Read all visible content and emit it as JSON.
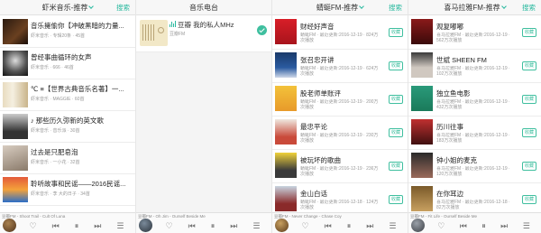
{
  "colors": {
    "accent": "#29b99f",
    "fav_border": "#3fbf9f"
  },
  "screens": [
    {
      "header": {
        "title": "虾米音乐-推荐",
        "right": "搜索"
      },
      "items": [
        {
          "title": "音乐擁偷你【冲破黑暗的力量...",
          "sub": "虾米音乐 · 专辑20条 · 45首"
        },
        {
          "title": "曾经事曲循环的女声",
          "sub": "虾米音乐 · 666 · 46首"
        },
        {
          "title": "℃ ≡【世界古典音乐名著】一...",
          "sub": "虾米音乐 · MAGGIE · 60首"
        },
        {
          "title": "♪ 那些历久弥新的英文歌",
          "sub": "虾米音乐 · 音乐派 · 30首"
        },
        {
          "title": "过去是只肥皂泡",
          "sub": "虾米音乐 · 一小花 · 32首"
        },
        {
          "title": "聆听故事和民谣——2016民谣...",
          "sub": "虾米音乐 · 李 大的日子 · 34首"
        }
      ],
      "player": {
        "now": "豆瓣FM - Shoot Trail - Cult Of Luna"
      }
    },
    {
      "header": {
        "title": "音乐电台",
        "right": ""
      },
      "items": [
        {
          "title": "豆瓣 我的私人MHz",
          "sub": "豆瓣FM"
        }
      ],
      "player": {
        "now": "豆瓣FM - Oh Jim - Ourself Beside Me"
      }
    },
    {
      "header": {
        "title": "蜻蜓FM-推荐",
        "right": "搜索"
      },
      "items": [
        {
          "title": "财经好声音",
          "sub": "蜻蜓FM · 最近更新:2016-12-19 · 824万次播放",
          "fav": "收藏"
        },
        {
          "title": "张召忠开讲",
          "sub": "蜻蜓FM · 最近更新:2016-12-19 · 624万次播放",
          "fav": "收藏"
        },
        {
          "title": "股老师单账评",
          "sub": "蜻蜓FM · 最近更新:2016-12-19 · 200万次播放",
          "fav": "收藏"
        },
        {
          "title": "最忠平论",
          "sub": "蜻蜓FM · 最近更新:2016-12-19 · 230万次播放",
          "fav": "收藏"
        },
        {
          "title": "被玩坏的歌曲",
          "sub": "蜻蜓FM · 最近更新:2016-12-19 · 236万次播放",
          "fav": "收藏"
        },
        {
          "title": "金山白话",
          "sub": "蜻蜓FM · 最近更新:2016-12-18 · 124万次播放",
          "fav": "收藏"
        }
      ],
      "player": {
        "now": "豆瓣FM - Never Change - Chase Coy"
      }
    },
    {
      "header": {
        "title": "喜马拉雅FM-推荐",
        "right": "搜索"
      },
      "items": [
        {
          "title": "观复嘟嘟",
          "sub": "喜马拉雅FM · 最近更新:2016-12-19 · 562万次播放",
          "fav": "收藏"
        },
        {
          "title": "世斌 SHEEN FM",
          "sub": "喜马拉雅FM · 最近更新:2016-12-19 · 102万次播放",
          "fav": "收藏"
        },
        {
          "title": "独立鱼电影",
          "sub": "喜马拉雅FM · 最近更新:2016-12-19 · 432万次播放",
          "fav": "收藏"
        },
        {
          "title": "历川往事",
          "sub": "喜马拉雅FM · 最近更新:2016-12-19 · 183万次播放",
          "fav": "收藏"
        },
        {
          "title": "钟小姐的麦克",
          "sub": "喜马拉雅FM · 最近更新:2016-12-19 · 120万次播放",
          "fav": "收藏"
        },
        {
          "title": "在你耳边",
          "sub": "喜马拉雅FM · 最近更新:2016-12-18 · 82万次播放",
          "fav": "收藏"
        }
      ],
      "player": {
        "now": "豆瓣FM - Fit Life - Ourself Beside Me"
      }
    }
  ],
  "player_icons": [
    "heart-icon",
    "previous-icon",
    "pause-icon",
    "next-icon",
    "playlist-icon"
  ]
}
